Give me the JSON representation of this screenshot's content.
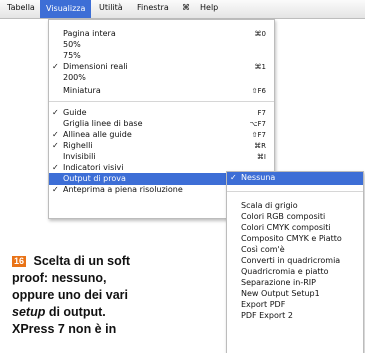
{
  "menubar": {
    "items": [
      "Tabella",
      "Visualizza",
      "Utilità",
      "Finestra",
      "⌘",
      "Help"
    ],
    "active_index": 1
  },
  "visualizza_menu": {
    "items": [
      {
        "check": "",
        "label": "Pagina intera",
        "shortcut": "⌘0"
      },
      {
        "check": "",
        "label": "50%",
        "shortcut": ""
      },
      {
        "check": "",
        "label": "75%",
        "shortcut": ""
      },
      {
        "check": "✓",
        "label": "Dimensioni reali",
        "shortcut": "⌘1"
      },
      {
        "check": "",
        "label": "200%",
        "shortcut": ""
      },
      {
        "check": "",
        "label": "Miniatura",
        "shortcut": "⇧F6"
      },
      {
        "check": "✓",
        "label": "Guide",
        "shortcut": "F7"
      },
      {
        "check": "",
        "label": "Griglia linee di base",
        "shortcut": "⌥F7"
      },
      {
        "check": "✓",
        "label": "Allinea alle guide",
        "shortcut": "⇧F7"
      },
      {
        "check": "✓",
        "label": "Righelli",
        "shortcut": "⌘R"
      },
      {
        "check": "",
        "label": "Invisibili",
        "shortcut": "⌘I"
      },
      {
        "check": "✓",
        "label": "Indicatori visivi",
        "shortcut": ""
      },
      {
        "check": "",
        "label": "Output di prova",
        "shortcut": "",
        "submenu": "▶"
      },
      {
        "check": "✓",
        "label": "Anteprima a piena risoluzione",
        "shortcut": ""
      }
    ]
  },
  "output_submenu": {
    "items": [
      {
        "check": "✓",
        "label": "Nessuna"
      },
      {
        "check": "",
        "label": "Scala di grigio"
      },
      {
        "check": "",
        "label": "Colori RGB compositi"
      },
      {
        "check": "",
        "label": "Colori CMYK compositi"
      },
      {
        "check": "",
        "label": "Composito CMYK e Piatto"
      },
      {
        "check": "",
        "label": "Così com'è"
      },
      {
        "check": "",
        "label": "Converti in quadricromia"
      },
      {
        "check": "",
        "label": "Quadricromia e piatto"
      },
      {
        "check": "",
        "label": "Separazione in-RIP"
      },
      {
        "check": "",
        "label": "New Output Setup1"
      },
      {
        "check": "",
        "label": "Export PDF"
      },
      {
        "check": "",
        "label": "PDF Export 2"
      }
    ]
  },
  "caption": {
    "number": "16",
    "line1": " Scelta di un soft",
    "line2": "proof: nessuno,",
    "line3": "oppure uno dei vari",
    "line4_it": "setup",
    "line4_rest": " di output.",
    "line5": "XPress 7 non è in"
  },
  "colors": {
    "highlight": "#3d6ed6",
    "badge": "#e97317"
  }
}
